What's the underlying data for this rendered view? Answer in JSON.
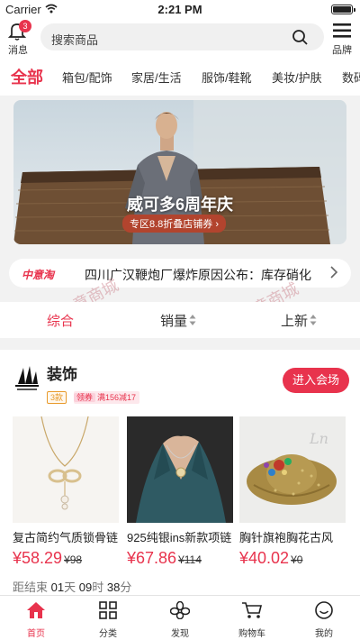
{
  "status_bar": {
    "carrier": "Carrier",
    "time": "2:21 PM"
  },
  "header": {
    "messages_label": "消息",
    "messages_badge": "3",
    "search_placeholder": "搜索商品",
    "brand_label": "品牌"
  },
  "categories": [
    "全部",
    "箱包/配饰",
    "家居/生活",
    "服饰/鞋靴",
    "美妆/护肤",
    "数码"
  ],
  "banner": {
    "title": "威可多6周年庆",
    "subtitle": "专区8.8折叠店铺券 ›"
  },
  "ticker": {
    "brand": "中意淘",
    "text": "四川广汉鞭炮厂爆炸原因公布：库存硝化"
  },
  "sort": {
    "comprehensive": "综合",
    "sales": "销量",
    "newest": "上新"
  },
  "watermark": "中意商城",
  "venue": {
    "name": "装饰",
    "tag": "3款",
    "coupon_kind": "领券",
    "coupon_text": "满156减17",
    "enter_button": "进入会场",
    "countdown": {
      "prefix": "距结束",
      "days": "01",
      "d_unit": "天",
      "hours": "09",
      "h_unit": "时",
      "minutes": "38",
      "m_unit": "分"
    }
  },
  "products": [
    {
      "title": "复古简约气质锁骨链",
      "price": "¥58.29",
      "original": "¥98"
    },
    {
      "title": "925纯银ins新款项链",
      "price": "¥67.86",
      "original": "¥114"
    },
    {
      "title": "胸针旗袍胸花古风",
      "price": "¥40.02",
      "original": "¥0"
    }
  ],
  "tabbar": [
    "首页",
    "分类",
    "发现",
    "购物车",
    "我的"
  ],
  "colors": {
    "accent": "#e8334d"
  }
}
